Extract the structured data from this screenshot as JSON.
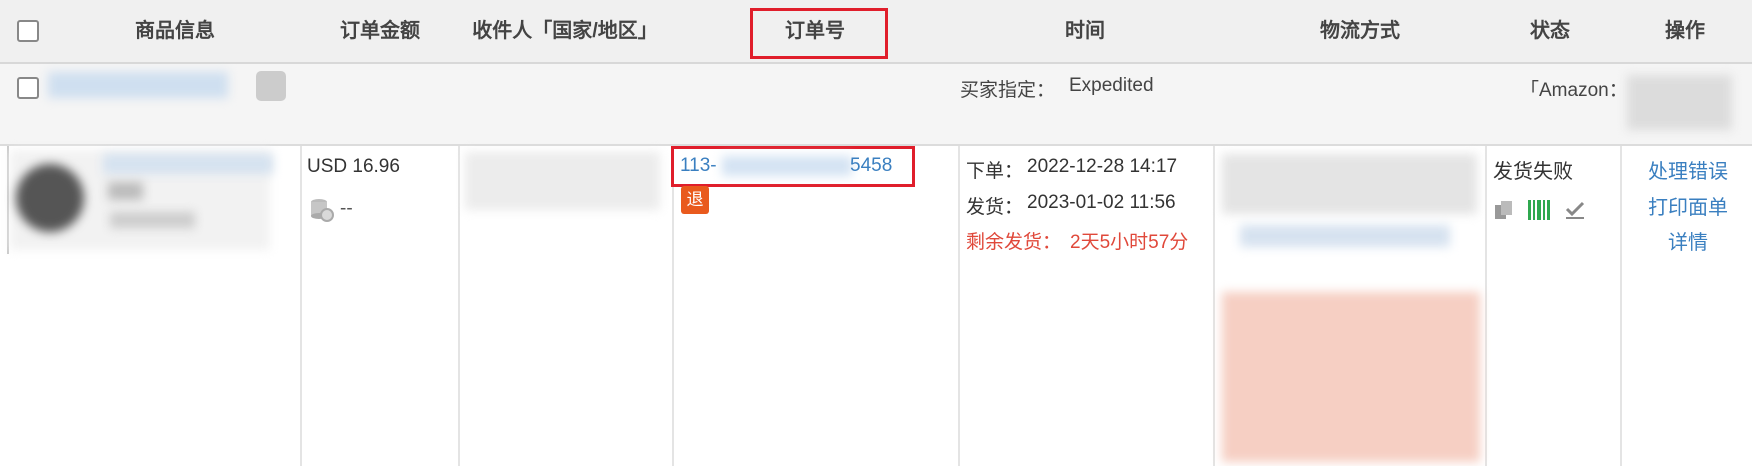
{
  "header": {
    "columns": [
      "商品信息",
      "订单金额",
      "收件人「国家/地区」",
      "订单号",
      "时间",
      "物流方式",
      "状态",
      "操作"
    ]
  },
  "group": {
    "buyer_label": "买家指定：",
    "buyer_value": "Expedited",
    "amazon_label": "「Amazon："
  },
  "order": {
    "amount": "USD 16.96",
    "amount_extra": "--",
    "order_no": "113-",
    "order_no_tail": "5458",
    "return_badge": "退",
    "placed_label": "下单：",
    "placed_time": "2022-12-28 14:17",
    "shipped_label": "发货：",
    "shipped_time": "2023-01-02 11:56",
    "remaining_label": "剩余发货：",
    "remaining_value": "2天5小时57分",
    "status": "发货失败",
    "actions": [
      "处理错误",
      "打印面单",
      "详情"
    ]
  },
  "colors": {
    "link": "#3a7fc0",
    "highlight": "#e01e2b",
    "badge": "#e95a1d",
    "warning": "#e0483a",
    "icon_green": "#2fa84f"
  }
}
